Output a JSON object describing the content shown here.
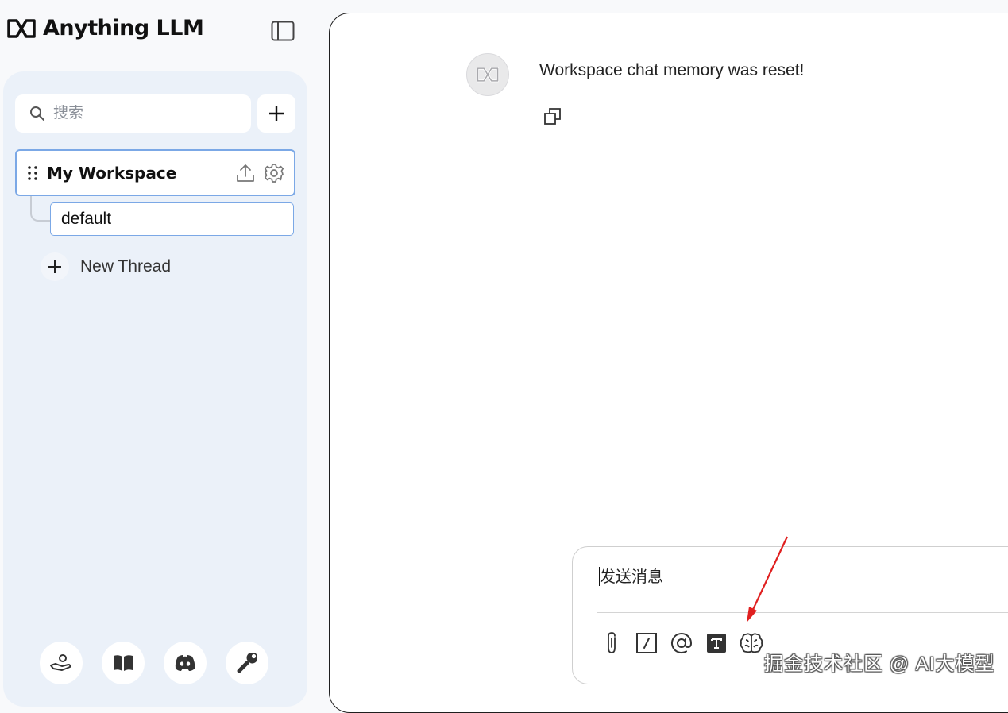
{
  "app": {
    "name": "Anything LLM"
  },
  "sidebar": {
    "search_placeholder": "搜索",
    "workspace": {
      "label": "My Workspace"
    },
    "threads": [
      {
        "label": "default"
      }
    ],
    "new_thread_label": "New Thread",
    "footer_icons": [
      "community-hub-icon",
      "docs-book-icon",
      "discord-icon",
      "settings-wrench-icon"
    ]
  },
  "chat": {
    "messages": [
      {
        "role": "assistant",
        "text": "Workspace chat memory was reset!"
      }
    ]
  },
  "composer": {
    "placeholder": "发送消息",
    "tools": [
      "attach-icon",
      "slash-command-icon",
      "at-agent-icon",
      "text-size-icon",
      "brain-llm-icon"
    ]
  },
  "annotation": {
    "color": "#e02020"
  },
  "watermark": "掘金技术社区 @ AI大模型"
}
